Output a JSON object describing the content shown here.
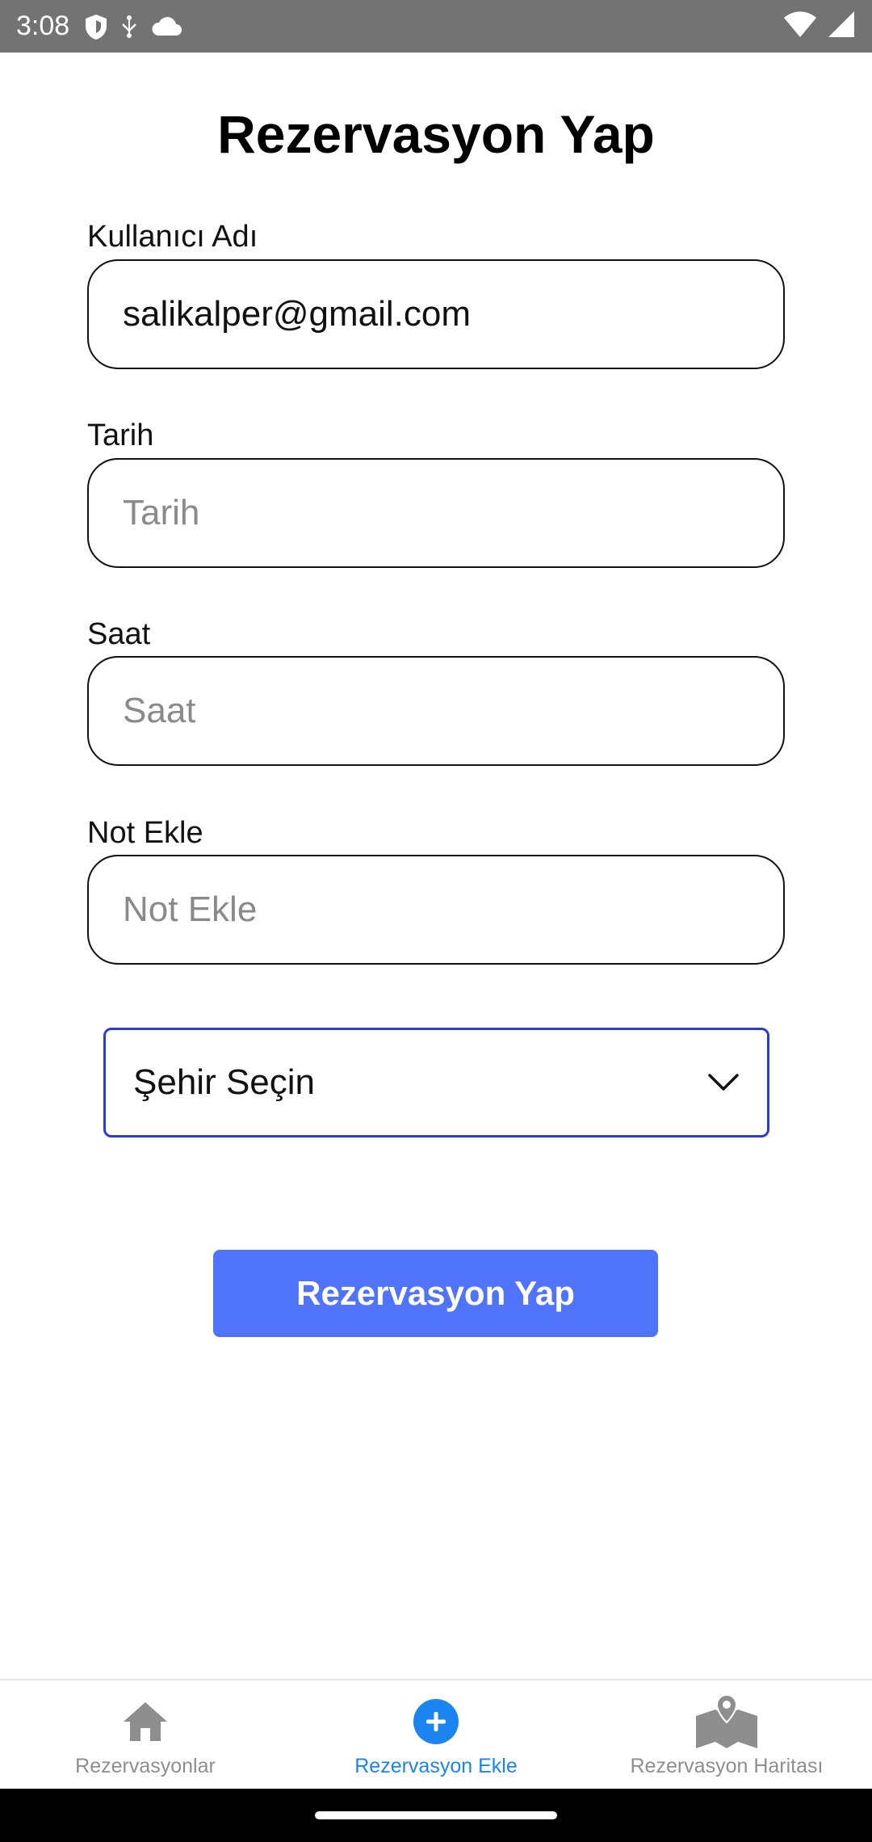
{
  "status_bar": {
    "time": "3:08",
    "icons": [
      "shield-icon",
      "usb-icon",
      "cloud-icon",
      "wifi-icon",
      "signal-icon"
    ]
  },
  "page": {
    "title": "Rezervasyon Yap"
  },
  "form": {
    "username": {
      "label": "Kullanıcı Adı",
      "value": "salikalper@gmail.com",
      "placeholder": ""
    },
    "date": {
      "label": "Tarih",
      "value": "",
      "placeholder": "Tarih"
    },
    "time": {
      "label": "Saat",
      "value": "",
      "placeholder": "Saat"
    },
    "note": {
      "label": "Not Ekle",
      "value": "",
      "placeholder": "Not Ekle"
    },
    "city": {
      "selected": "Şehir Seçin"
    },
    "submit_label": "Rezervasyon Yap"
  },
  "tabs": [
    {
      "label": "Rezervasyonlar",
      "icon": "home-icon",
      "active": false
    },
    {
      "label": "Rezervasyon Ekle",
      "icon": "add-circle-icon",
      "active": true
    },
    {
      "label": "Rezervasyon Haritası",
      "icon": "map-icon",
      "active": false
    }
  ],
  "colors": {
    "primary_button": "#4f74fb",
    "active_tab": "#1a84f0",
    "dropdown_border": "#2b3bd6",
    "status_bar": "#737373"
  }
}
